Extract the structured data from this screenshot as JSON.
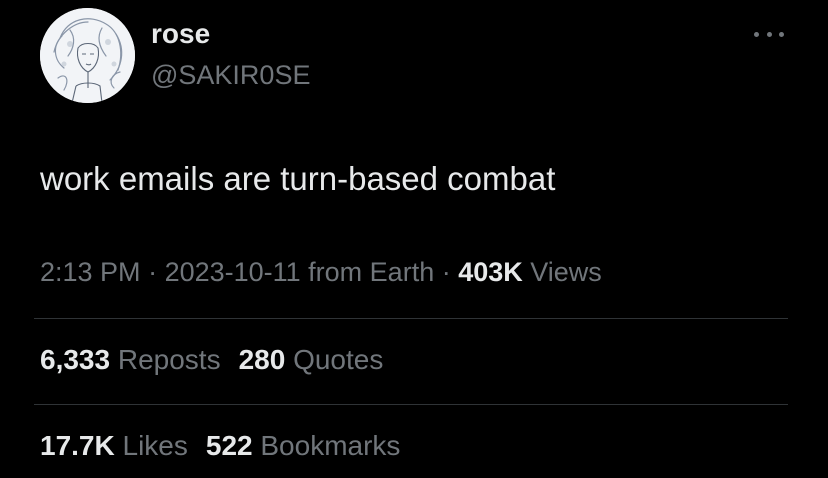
{
  "author": {
    "name": "rose",
    "handle": "@SAKIR0SE"
  },
  "tweet": {
    "text": "work emails are turn-based combat"
  },
  "meta": {
    "time": "2:13 PM",
    "sep1": " · ",
    "date": "2023-10-11",
    "source": " from Earth",
    "sep2": " · ",
    "views_count": "403K",
    "views_label": " Views"
  },
  "stats": {
    "reposts_count": "6,333",
    "reposts_label": " Reposts",
    "quotes_count": "280",
    "quotes_label": " Quotes",
    "likes_count": "17.7K",
    "likes_label": " Likes",
    "bookmarks_count": "522",
    "bookmarks_label": " Bookmarks"
  },
  "icons": {
    "more": "more-options-icon"
  },
  "colors": {
    "background": "#000000",
    "primary_text": "#e7e9ea",
    "secondary_text": "#71767b",
    "divider": "#2f3336"
  }
}
